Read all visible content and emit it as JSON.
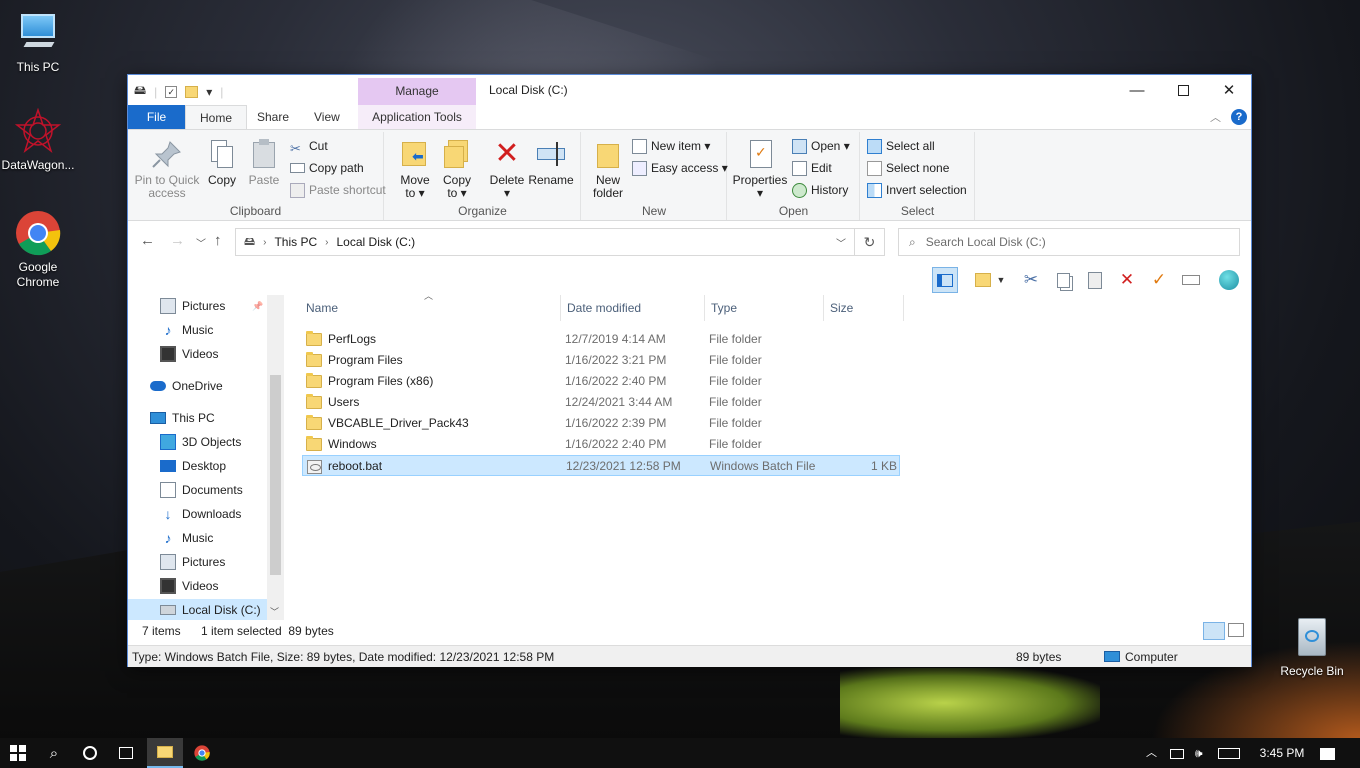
{
  "desktop": {
    "icons": [
      {
        "label": "This PC"
      },
      {
        "label": "DataWagon..."
      },
      {
        "label": "Google\nChrome"
      },
      {
        "label": "Recycle Bin"
      }
    ]
  },
  "window": {
    "title": "Local Disk (C:)",
    "manage_tab": "Manage",
    "tabs": [
      "File",
      "Home",
      "Share",
      "View",
      "Application Tools"
    ],
    "ribbon": {
      "clipboard": {
        "label": "Clipboard",
        "pin": "Pin to Quick\naccess",
        "copy": "Copy",
        "paste": "Paste",
        "cut": "Cut",
        "copy_path": "Copy path",
        "paste_shortcut": "Paste shortcut"
      },
      "organize": {
        "label": "Organize",
        "move_to": "Move\nto ▾",
        "copy_to": "Copy\nto ▾",
        "delete": "Delete\n▾",
        "rename": "Rename"
      },
      "new": {
        "label": "New",
        "new_folder": "New\nfolder",
        "new_item": "New item ▾",
        "easy_access": "Easy access ▾"
      },
      "open": {
        "label": "Open",
        "properties": "Properties\n▾",
        "open": "Open ▾",
        "edit": "Edit",
        "history": "History"
      },
      "select": {
        "label": "Select",
        "select_all": "Select all",
        "select_none": "Select none",
        "invert": "Invert selection"
      }
    },
    "address": {
      "crumbs": [
        "This PC",
        "Local Disk (C:)"
      ],
      "search_placeholder": "Search Local Disk (C:)"
    },
    "nav_pane": [
      {
        "label": "Pictures",
        "icon": "pictures-icon",
        "indent": 2,
        "pinned": true
      },
      {
        "label": "Music",
        "icon": "music-icon",
        "indent": 2
      },
      {
        "label": "Videos",
        "icon": "videos-icon",
        "indent": 2
      },
      {
        "label": "OneDrive",
        "icon": "onedrive-icon",
        "indent": 1
      },
      {
        "label": "This PC",
        "icon": "this-pc-icon",
        "indent": 1
      },
      {
        "label": "3D Objects",
        "icon": "3d-objects-icon",
        "indent": 2
      },
      {
        "label": "Desktop",
        "icon": "desktop-icon",
        "indent": 2
      },
      {
        "label": "Documents",
        "icon": "documents-icon",
        "indent": 2
      },
      {
        "label": "Downloads",
        "icon": "downloads-icon",
        "indent": 2
      },
      {
        "label": "Music",
        "icon": "music-icon",
        "indent": 2
      },
      {
        "label": "Pictures",
        "icon": "pictures-icon",
        "indent": 2
      },
      {
        "label": "Videos",
        "icon": "videos-icon",
        "indent": 2
      },
      {
        "label": "Local Disk (C:)",
        "icon": "drive-icon",
        "indent": 2,
        "selected": true
      }
    ],
    "columns": [
      "Name",
      "Date modified",
      "Type",
      "Size"
    ],
    "files": [
      {
        "name": "PerfLogs",
        "date": "12/7/2019 4:14 AM",
        "type": "File folder",
        "size": "",
        "icon": "folder"
      },
      {
        "name": "Program Files",
        "date": "1/16/2022 3:21 PM",
        "type": "File folder",
        "size": "",
        "icon": "folder"
      },
      {
        "name": "Program Files (x86)",
        "date": "1/16/2022 2:40 PM",
        "type": "File folder",
        "size": "",
        "icon": "folder"
      },
      {
        "name": "Users",
        "date": "12/24/2021 3:44 AM",
        "type": "File folder",
        "size": "",
        "icon": "folder"
      },
      {
        "name": "VBCABLE_Driver_Pack43",
        "date": "1/16/2022 2:39 PM",
        "type": "File folder",
        "size": "",
        "icon": "folder"
      },
      {
        "name": "Windows",
        "date": "1/16/2022 2:40 PM",
        "type": "File folder",
        "size": "",
        "icon": "folder"
      },
      {
        "name": "reboot.bat",
        "date": "12/23/2021 12:58 PM",
        "type": "Windows Batch File",
        "size": "1 KB",
        "icon": "bat",
        "selected": true
      }
    ],
    "status": {
      "count": "7 items",
      "selected": "1 item selected  89 bytes"
    },
    "details": {
      "text": "Type: Windows Batch File, Size: 89 bytes, Date modified: 12/23/2021 12:58 PM",
      "size": "89 bytes",
      "location": "Computer"
    }
  },
  "taskbar": {
    "clock": "3:45 PM"
  }
}
